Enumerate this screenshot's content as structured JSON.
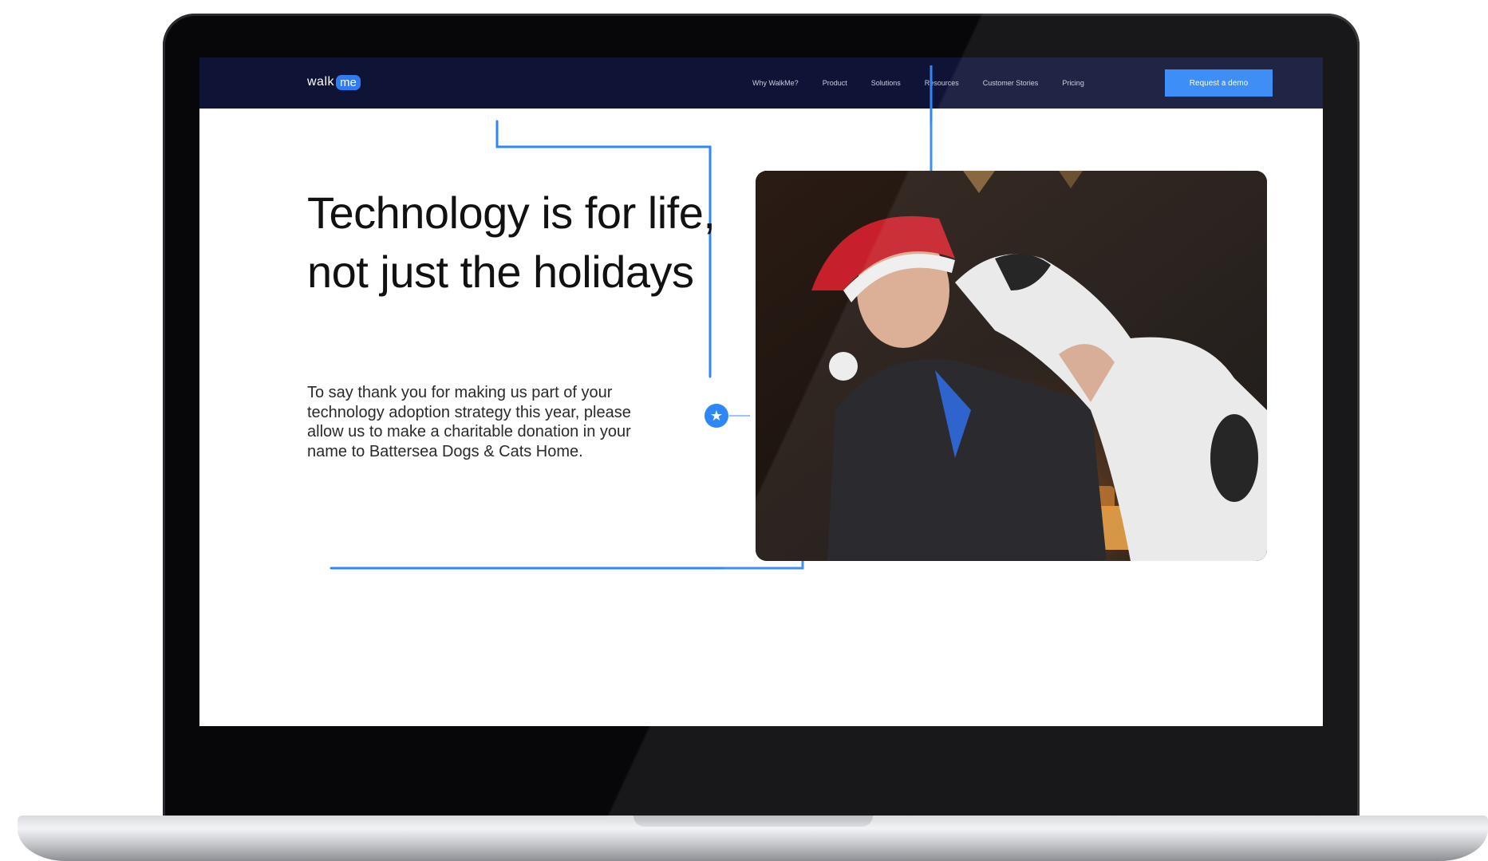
{
  "nav": {
    "logo_walk": "walk",
    "logo_me": "me",
    "links": [
      "Why WalkMe?",
      "Product",
      "Solutions",
      "Resources",
      "Customer Stories",
      "Pricing"
    ],
    "cta_label": "Request a demo"
  },
  "hero": {
    "title": "Technology is for life, not just the holidays",
    "body": "To say thank you for making us part of your technology adoption strategy this year, please allow us to make a charitable donation in your name to Battersea Dogs & Cats Home."
  },
  "icons": {
    "marker": "star-icon"
  },
  "colors": {
    "nav_background": "#0f1437",
    "accent_blue": "#2f86f6"
  }
}
